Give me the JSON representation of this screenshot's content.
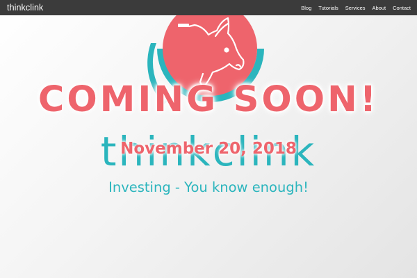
{
  "navbar": {
    "brand": "thinkclink",
    "links": [
      "Blog",
      "Tutorials",
      "Services",
      "About",
      "Contact"
    ]
  },
  "hero": {
    "logo_icon": "piggy-bank-logo",
    "headline": "COMING SOON!",
    "wordmark": "thinkclink",
    "launch_date": "November 20, 2018",
    "tagline": "Investing - You know enough!"
  },
  "colors": {
    "navbar_bg": "#3b3b3b",
    "accent_coral": "#ee646c",
    "accent_teal": "#2bb5bd"
  }
}
